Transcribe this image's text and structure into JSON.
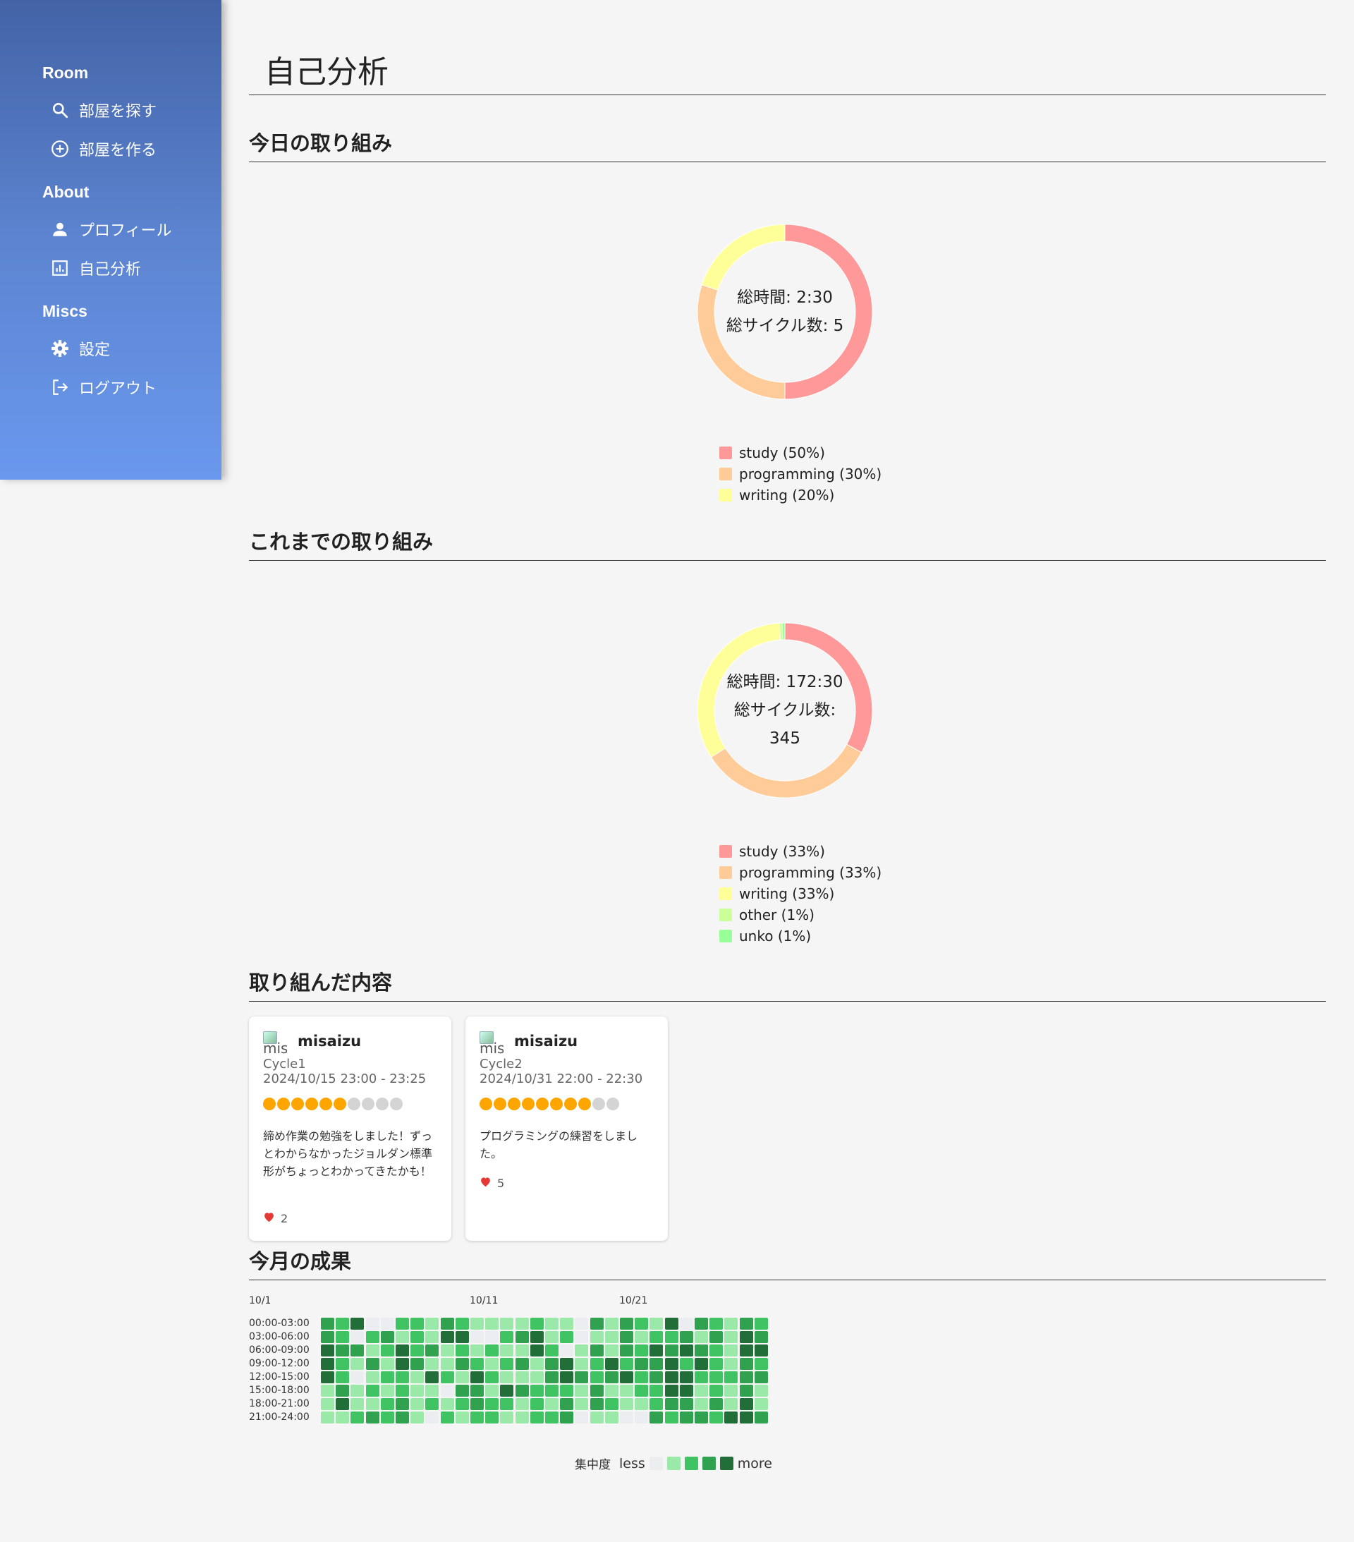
{
  "sidebar": {
    "sections": [
      {
        "title": "Room",
        "items": [
          {
            "label": "部屋を探す",
            "icon": "search-icon"
          },
          {
            "label": "部屋を作る",
            "icon": "add-circle-icon"
          }
        ]
      },
      {
        "title": "About",
        "items": [
          {
            "label": "プロフィール",
            "icon": "person-icon"
          },
          {
            "label": "自己分析",
            "icon": "analytics-icon"
          }
        ]
      },
      {
        "title": "Miscs",
        "items": [
          {
            "label": "設定",
            "icon": "gear-icon"
          },
          {
            "label": "ログアウト",
            "icon": "logout-icon"
          }
        ]
      }
    ]
  },
  "page": {
    "title": "自己分析"
  },
  "today": {
    "heading": "今日の取り組み",
    "total_time": "総時間: 2:30",
    "total_cycles": "総サイクル数: 5"
  },
  "alltime": {
    "heading": "これまでの取り組み",
    "total_time": "総時間: 172:30",
    "total_cycles_label": "総サイクル数:",
    "total_cycles_value": "345"
  },
  "posts": {
    "heading": "取り組んだ内容",
    "cards": [
      {
        "avatar_alt": "mis",
        "username": "misaizu",
        "cycle": "Cycle1",
        "time": "2024/10/15 23:00 - 23:25",
        "rating": 6,
        "rating_max": 10,
        "comment": "締め作業の勉強をしました！ずっとわからなかったジョルダン標準形がちょっとわかってきたかも！",
        "likes": "2"
      },
      {
        "avatar_alt": "mis",
        "username": "misaizu",
        "cycle": "Cycle2",
        "time": "2024/10/31 22:00 - 22:30",
        "rating": 8,
        "rating_max": 10,
        "comment": "プログラミングの練習をしました。",
        "likes": "5"
      }
    ]
  },
  "monthly": {
    "heading": "今月の成果",
    "legend_title": "集中度",
    "legend_less": "less",
    "legend_more": "more"
  },
  "colors": {
    "study": "#ff9999",
    "programming": "#ffcc99",
    "writing": "#ffff99",
    "other": "#ccff99",
    "unko": "#99ff99",
    "heat": [
      "#ebedf0",
      "#9be9a8",
      "#40c463",
      "#30a14e",
      "#216e39"
    ]
  },
  "chart_data": [
    {
      "type": "pie",
      "slices": [
        {
          "label": "study (50%)",
          "value": 50,
          "color": "#ff9999"
        },
        {
          "label": "programming (30%)",
          "value": 30,
          "color": "#ffcc99"
        },
        {
          "label": "writing (20%)",
          "value": 20,
          "color": "#ffff99"
        }
      ]
    },
    {
      "type": "pie",
      "slices": [
        {
          "label": "study (33%)",
          "value": 33,
          "color": "#ff9999"
        },
        {
          "label": "programming (33%)",
          "value": 33,
          "color": "#ffcc99"
        },
        {
          "label": "writing (33%)",
          "value": 33,
          "color": "#ffff99"
        },
        {
          "label": "other (1%)",
          "value": 0.5,
          "color": "#ccff99"
        },
        {
          "label": "unko (1%)",
          "value": 0.5,
          "color": "#99ff99"
        }
      ]
    },
    {
      "type": "heatmap",
      "x_tick_labels": [
        {
          "label": "10/1",
          "day": 1
        },
        {
          "label": "10/11",
          "day": 11
        },
        {
          "label": "10/21",
          "day": 21
        }
      ],
      "days": 30,
      "rows": [
        "00:00-03:00",
        "03:00-06:00",
        "06:00-09:00",
        "09:00-12:00",
        "12:00-15:00",
        "15:00-18:00",
        "18:00-21:00",
        "21:00-24:00"
      ],
      "levels": [
        [
          3,
          2,
          4,
          0,
          0,
          2,
          2,
          1,
          3,
          2,
          1,
          1,
          1,
          1,
          2,
          1,
          1,
          0,
          3,
          1,
          3,
          2,
          1,
          4,
          0,
          3,
          2,
          1,
          3,
          2
        ],
        [
          3,
          2,
          0,
          2,
          3,
          1,
          2,
          1,
          4,
          4,
          0,
          0,
          2,
          3,
          4,
          1,
          2,
          0,
          1,
          1,
          3,
          1,
          2,
          2,
          3,
          1,
          3,
          1,
          4,
          3
        ],
        [
          4,
          3,
          3,
          1,
          2,
          4,
          2,
          3,
          1,
          2,
          1,
          2,
          1,
          1,
          4,
          2,
          0,
          1,
          3,
          1,
          3,
          2,
          4,
          3,
          4,
          3,
          2,
          1,
          4,
          4
        ],
        [
          4,
          2,
          1,
          3,
          1,
          4,
          3,
          1,
          1,
          3,
          2,
          1,
          2,
          3,
          1,
          3,
          4,
          1,
          2,
          4,
          2,
          3,
          3,
          4,
          2,
          4,
          2,
          1,
          3,
          2
        ],
        [
          4,
          2,
          0,
          1,
          2,
          2,
          1,
          4,
          2,
          1,
          4,
          2,
          1,
          1,
          1,
          3,
          4,
          3,
          2,
          3,
          4,
          2,
          3,
          4,
          4,
          2,
          2,
          2,
          3,
          3
        ],
        [
          1,
          3,
          1,
          2,
          1,
          2,
          1,
          1,
          0,
          3,
          3,
          1,
          4,
          3,
          2,
          2,
          2,
          1,
          3,
          1,
          1,
          2,
          2,
          4,
          4,
          1,
          2,
          1,
          3,
          1
        ],
        [
          1,
          4,
          1,
          1,
          2,
          3,
          1,
          2,
          1,
          2,
          3,
          2,
          2,
          1,
          2,
          1,
          3,
          1,
          3,
          2,
          1,
          1,
          2,
          3,
          3,
          1,
          3,
          1,
          4,
          1
        ],
        [
          1,
          1,
          2,
          3,
          2,
          3,
          1,
          0,
          2,
          1,
          2,
          2,
          1,
          1,
          2,
          2,
          3,
          0,
          1,
          1,
          0,
          0,
          3,
          2,
          3,
          3,
          2,
          4,
          4,
          3
        ]
      ]
    }
  ]
}
